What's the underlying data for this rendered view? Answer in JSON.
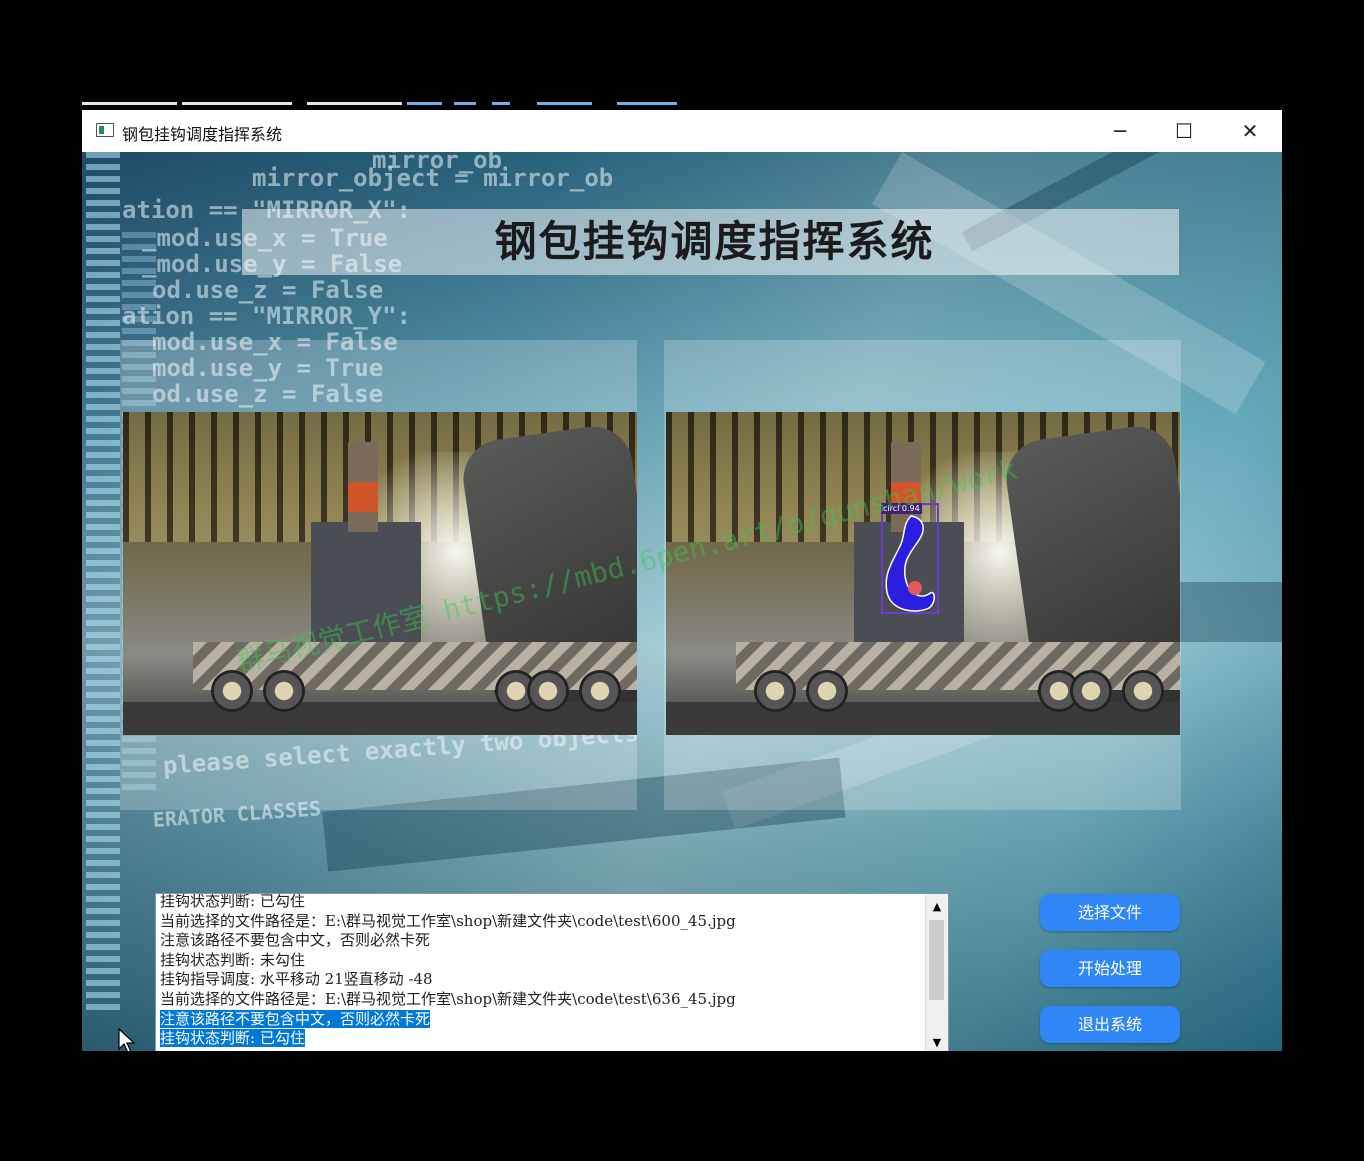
{
  "window": {
    "title": "钢包挂钩调度指挥系统",
    "controls": {
      "minimize": "─",
      "maximize": "☐",
      "close": "✕"
    }
  },
  "header": {
    "title": "钢包挂钩调度指挥系统"
  },
  "background_code": [
    "mirror_ob",
    "mirror_object = mirror_ob",
    "ation == \"MIRROR_X\":",
    "_mod.use_x = True",
    "_mod.use_y = False",
    "od.use_z = False",
    "ation == \"MIRROR_Y\":",
    "mod.use_x = False",
    "mod.use_y = True",
    "od.use_z = False",
    "please select exactly two objects",
    "ERATOR CLASSES"
  ],
  "watermark": "群马视觉工作室 https://mbd.6pen.art/o/qunshan/work",
  "detection": {
    "label": "circl 0.94",
    "box_color": "#6a3ccf",
    "mask_color": "#2a1fe0"
  },
  "log": {
    "lines": [
      "挂钩状态判断: 已勾住",
      "当前选择的文件路径是：E:\\群马视觉工作室\\shop\\新建文件夹\\code\\test\\600_45.jpg",
      "注意该路径不要包含中文，否则必然卡死",
      "挂钩状态判断: 未勾住",
      "挂钩指导调度: 水平移动 21竖直移动 -48",
      "当前选择的文件路径是：E:\\群马视觉工作室\\shop\\新建文件夹\\code\\test\\636_45.jpg",
      "注意该路径不要包含中文，否则必然卡死",
      "挂钩状态判断: 已勾住"
    ],
    "scroll_up": "▲",
    "scroll_down": "▼"
  },
  "buttons": {
    "select_file": "选择文件",
    "start_process": "开始处理",
    "exit_system": "退出系统"
  },
  "colors": {
    "accent_button": "#2f86f6",
    "selection": "#0078d7"
  }
}
